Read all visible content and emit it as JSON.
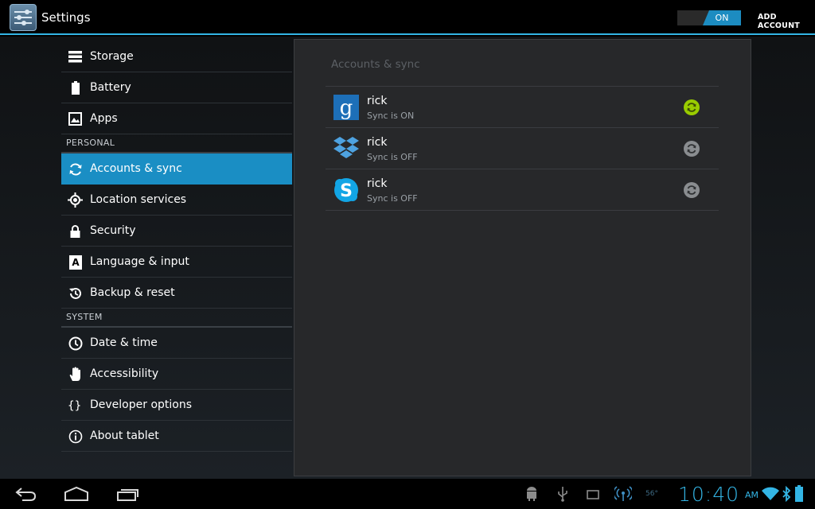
{
  "actionbar": {
    "title": "Settings",
    "toggle_label": "ON",
    "add_account_label": "ADD ACCOUNT"
  },
  "sidebar": {
    "items_top": [
      {
        "label": "Storage",
        "icon": "storage-icon"
      },
      {
        "label": "Battery",
        "icon": "battery-icon"
      },
      {
        "label": "Apps",
        "icon": "apps-icon"
      }
    ],
    "personal_header": "PERSONAL",
    "items_personal": [
      {
        "label": "Accounts & sync",
        "icon": "sync-icon",
        "selected": true
      },
      {
        "label": "Location services",
        "icon": "location-icon"
      },
      {
        "label": "Security",
        "icon": "lock-icon"
      },
      {
        "label": "Language & input",
        "icon": "language-icon"
      },
      {
        "label": "Backup & reset",
        "icon": "backup-icon"
      }
    ],
    "system_header": "SYSTEM",
    "items_system": [
      {
        "label": "Date & time",
        "icon": "clock-icon"
      },
      {
        "label": "Accessibility",
        "icon": "hand-icon"
      },
      {
        "label": "Developer options",
        "icon": "braces-icon"
      },
      {
        "label": "About tablet",
        "icon": "info-icon"
      }
    ]
  },
  "main": {
    "title": "Accounts & sync",
    "accounts": [
      {
        "name": "rick",
        "status": "Sync is ON",
        "logo": "google-icon",
        "sync_on": true
      },
      {
        "name": "rick",
        "status": "Sync is OFF",
        "logo": "dropbox-icon",
        "sync_on": false
      },
      {
        "name": "rick",
        "status": "Sync is OFF",
        "logo": "skype-icon",
        "sync_on": false
      }
    ]
  },
  "statusbar": {
    "temperature": "56°",
    "time": "10:40",
    "ampm": "AM"
  },
  "colors": {
    "accent": "#33b5e5",
    "selected": "#1a8ec4",
    "sync_on": "#99cc00",
    "sync_off": "#8a8d90"
  }
}
